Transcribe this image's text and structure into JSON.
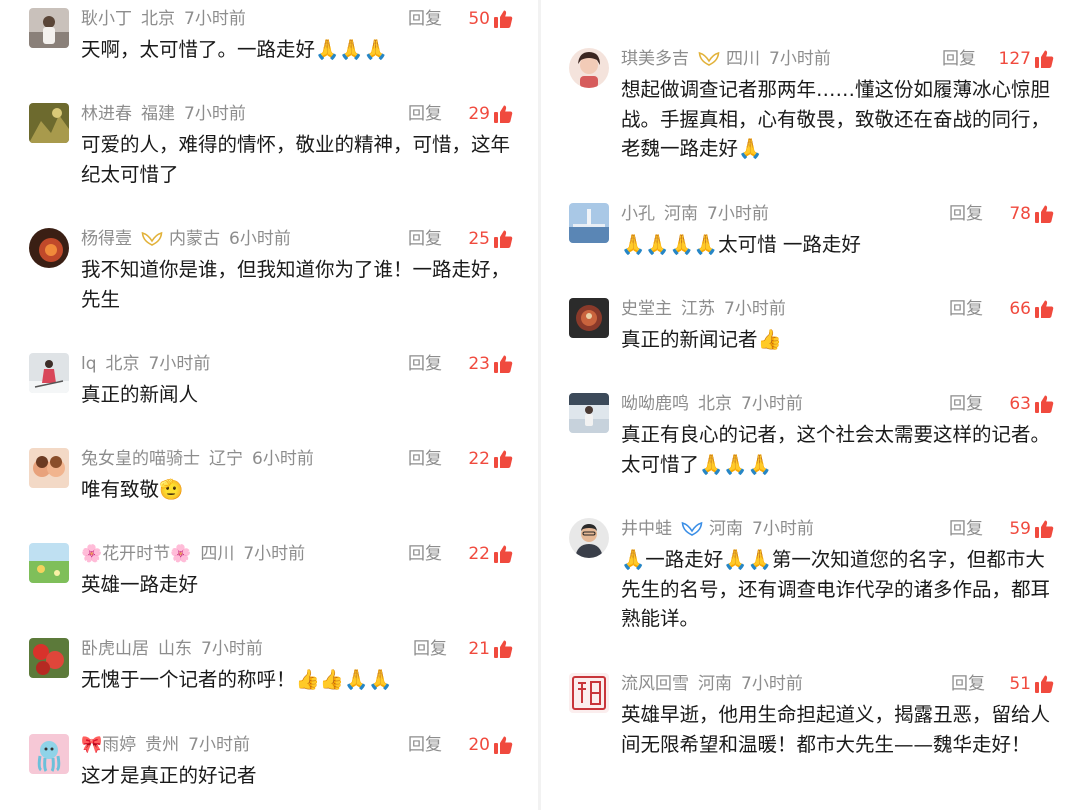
{
  "left_comments": [
    {
      "name": "耿小丁",
      "location": "北京",
      "time": "7小时前",
      "reply": "回复",
      "likes": "50",
      "text": "天啊，太可惜了。一路走好🙏🙏🙏"
    },
    {
      "name": "林进春",
      "location": "福建",
      "time": "7小时前",
      "reply": "回复",
      "likes": "29",
      "text": "可爱的人，难得的情怀，敬业的精神，可惜，这年纪太可惜了"
    },
    {
      "name": "杨得壹",
      "location": "内蒙古",
      "time": "6小时前",
      "reply": "回复",
      "likes": "25",
      "text": "我不知道你是谁，但我知道你为了谁！一路走好，先生"
    },
    {
      "name": "lq",
      "location": "北京",
      "time": "7小时前",
      "reply": "回复",
      "likes": "23",
      "text": "真正的新闻人"
    },
    {
      "name": "兔女皇的喵骑士",
      "location": "辽宁",
      "time": "6小时前",
      "reply": "回复",
      "likes": "22",
      "text": "唯有致敬🫡"
    },
    {
      "name": "🌸花开时节🌸",
      "location": "四川",
      "time": "7小时前",
      "reply": "回复",
      "likes": "22",
      "text": "英雄一路走好"
    },
    {
      "name": "卧虎山居",
      "location": "山东",
      "time": "7小时前",
      "reply": "回复",
      "likes": "21",
      "text": "无愧于一个记者的称呼！👍👍🙏🙏"
    },
    {
      "name": "🎀雨婷",
      "location": "贵州",
      "time": "7小时前",
      "reply": "回复",
      "likes": "20",
      "text": "这才是真正的好记者"
    }
  ],
  "right_comments": [
    {
      "name": "琪美多吉",
      "location": "四川",
      "time": "7小时前",
      "reply": "回复",
      "likes": "127",
      "badge": "gold-wings-badge-icon",
      "text": "想起做调查记者那两年……懂这份如履薄冰心惊胆战。手握真相，心有敬畏，致敬还在奋战的同行，老魏一路走好🙏"
    },
    {
      "name": "小孔",
      "location": "河南",
      "time": "7小时前",
      "reply": "回复",
      "likes": "78",
      "text": "🙏🙏🙏🙏太可惜 一路走好"
    },
    {
      "name": "史堂主",
      "location": "江苏",
      "time": "7小时前",
      "reply": "回复",
      "likes": "66",
      "text": "真正的新闻记者👍"
    },
    {
      "name": "呦呦鹿鸣",
      "location": "北京",
      "time": "7小时前",
      "reply": "回复",
      "likes": "63",
      "text": "真正有良心的记者，这个社会太需要这样的记者。太可惜了🙏🙏🙏"
    },
    {
      "name": "井中蛙",
      "location": "河南",
      "time": "7小时前",
      "reply": "回复",
      "likes": "59",
      "badge": "blue-wings-badge-icon",
      "text": "🙏一路走好🙏🙏第一次知道您的名字，但都市大先生的名号，还有调查电诈代孕的诸多作品，都耳熟能详。"
    },
    {
      "name": "流风回雪",
      "location": "河南",
      "time": "7小时前",
      "reply": "回复",
      "likes": "51",
      "text": "英雄早逝，他用生命担起道义，揭露丑恶，留给人间无限希望和温暖！都市大先生——魏华走好！"
    }
  ],
  "colors": {
    "likes": "#f04a3e",
    "meta": "#8d8d8d",
    "text": "#1a1a1a",
    "divider": "#f2f2f2"
  }
}
